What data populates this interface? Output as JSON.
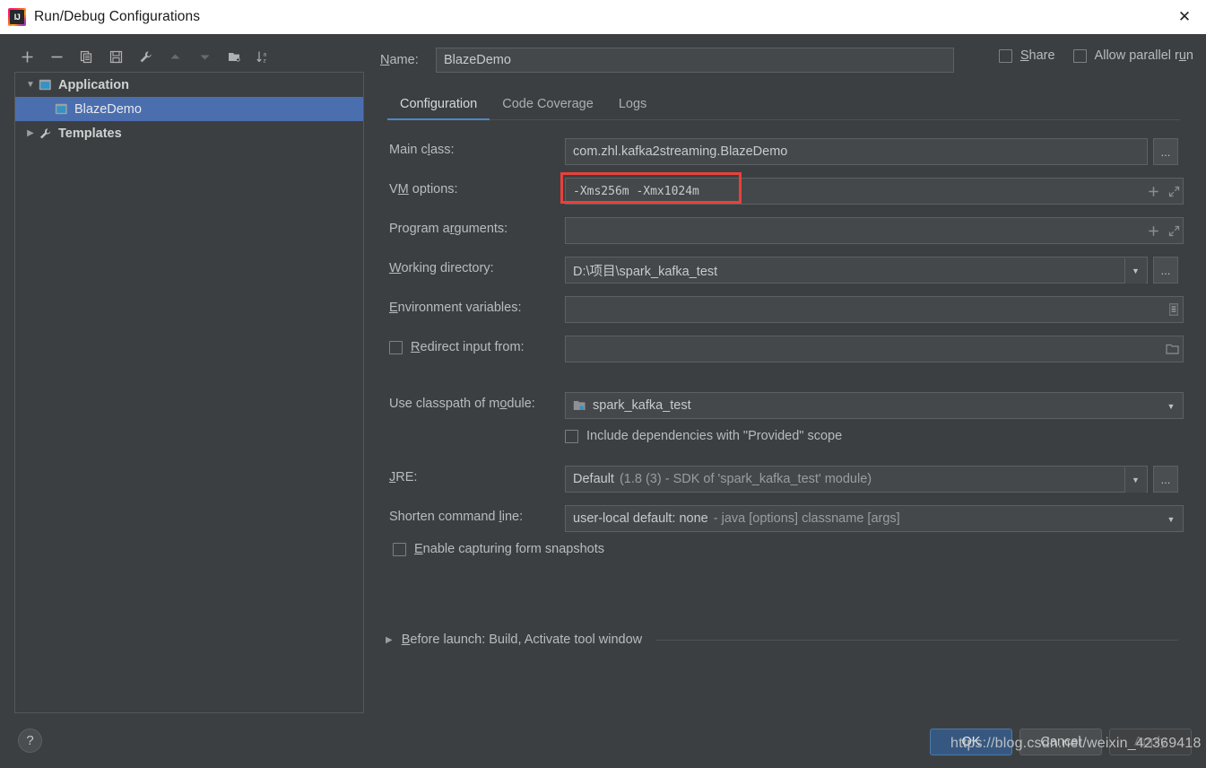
{
  "window": {
    "title": "Run/Debug Configurations",
    "logo_text": "IJ",
    "logo_icon": "intellij-idea-logo",
    "close_icon": "✕"
  },
  "toolbar": {
    "buttons": [
      {
        "name": "add-configuration-button",
        "icon": "plus-icon"
      },
      {
        "name": "remove-configuration-button",
        "icon": "minus-icon"
      },
      {
        "name": "copy-configuration-button",
        "icon": "copy-icon"
      },
      {
        "name": "save-configuration-button",
        "icon": "save-icon"
      },
      {
        "name": "edit-templates-button",
        "icon": "wrench-icon"
      },
      {
        "name": "move-up-button",
        "icon": "arrow-up-icon"
      },
      {
        "name": "move-down-button",
        "icon": "arrow-down-icon"
      },
      {
        "name": "new-folder-button",
        "icon": "folder-add-icon"
      },
      {
        "name": "sort-alphabetically-button",
        "icon": "sort-az-icon"
      }
    ]
  },
  "tree": {
    "items": [
      {
        "label": "Application",
        "icon": "application-icon",
        "expanded": true,
        "level": 0,
        "selected": false
      },
      {
        "label": "BlazeDemo",
        "icon": "application-icon",
        "level": 1,
        "selected": true
      },
      {
        "label": "Templates",
        "icon": "wrench-icon",
        "expanded": false,
        "level": 0,
        "selected": false
      }
    ]
  },
  "name_field": {
    "label_pre": "N",
    "label_post": "ame:",
    "value": "BlazeDemo",
    "placeholder": ""
  },
  "top_checkboxes": [
    {
      "name": "share-checkbox",
      "label_pre": "S",
      "label_post": "hare",
      "checked": false
    },
    {
      "name": "allow-parallel-run-checkbox",
      "label_pre": "Allow parallel r",
      "label_mid": "u",
      "label_post": "n",
      "checked": false
    }
  ],
  "tabs": [
    {
      "label": "Configuration",
      "active": true
    },
    {
      "label": "Code Coverage",
      "active": false
    },
    {
      "label": "Logs",
      "active": false
    }
  ],
  "fields": {
    "main_class": {
      "label_pre": "Main c",
      "label_mid": "l",
      "label_post": "ass:",
      "value": "com.zhl.kafka2streaming.BlazeDemo",
      "browse_label": "..."
    },
    "vm_options": {
      "label_pre": "V",
      "label_mid": "M",
      "label_post": " options:",
      "value": "-Xms256m -Xmx1024m",
      "highlighted": true,
      "highlight_color": "#e8413a",
      "icons": [
        "plus-icon",
        "expand-icon"
      ]
    },
    "program_arguments": {
      "label_pre": "Program a",
      "label_mid": "r",
      "label_post": "guments:",
      "value": "",
      "icons": [
        "plus-icon",
        "expand-icon"
      ]
    },
    "working_directory": {
      "label_pre": "W",
      "label_mid": "o",
      "label_post": "rking directory:",
      "value": "D:\\项目\\spark_kafka_test",
      "browse_label": "..."
    },
    "environment_variables": {
      "label_pre": "E",
      "label_mid": "n",
      "label_post": "vironment variables:",
      "value": "",
      "icon": "env-list-icon"
    },
    "redirect_input": {
      "label_pre": "R",
      "label_mid": "e",
      "label_post": "direct input from:",
      "checked": false,
      "value": "",
      "icon": "folder-open-icon"
    },
    "use_classpath_of_module": {
      "label_pre": "Use classpath of m",
      "label_mid": "o",
      "label_post": "dule:",
      "value": "spark_kafka_test",
      "icon": "module-icon"
    },
    "include_provided": {
      "label": "Include dependencies with \"Provided\" scope",
      "checked": false
    },
    "jre": {
      "label_pre": "J",
      "label_mid": "R",
      "label_post": "E:",
      "value_main": "Default",
      "value_dim": "(1.8 (3) - SDK of 'spark_kafka_test' module)",
      "browse_label": "..."
    },
    "shorten_command_line": {
      "label_pre": "Shorten command ",
      "label_mid": "l",
      "label_post": "ine:",
      "value_main": "user-local default: none",
      "value_dim": "- java [options] classname [args]"
    },
    "enable_capturing": {
      "label_pre": "E",
      "label_mid": "n",
      "label_post": "able capturing form snapshots",
      "checked": false
    }
  },
  "before_launch": {
    "arrow": "▶",
    "label_pre": "B",
    "label_mid": "e",
    "label_post": "fore launch: Build, Activate tool window"
  },
  "footer": {
    "help_label": "?",
    "buttons": [
      {
        "name": "ok-button",
        "label": "OK",
        "style": "primary"
      },
      {
        "name": "cancel-button",
        "label": "Cancel",
        "style": "normal"
      },
      {
        "name": "apply-button",
        "label": "Apply",
        "style": "disabled"
      }
    ]
  },
  "watermark": {
    "text": "https://blog.csdn.net/weixin_42369418"
  }
}
